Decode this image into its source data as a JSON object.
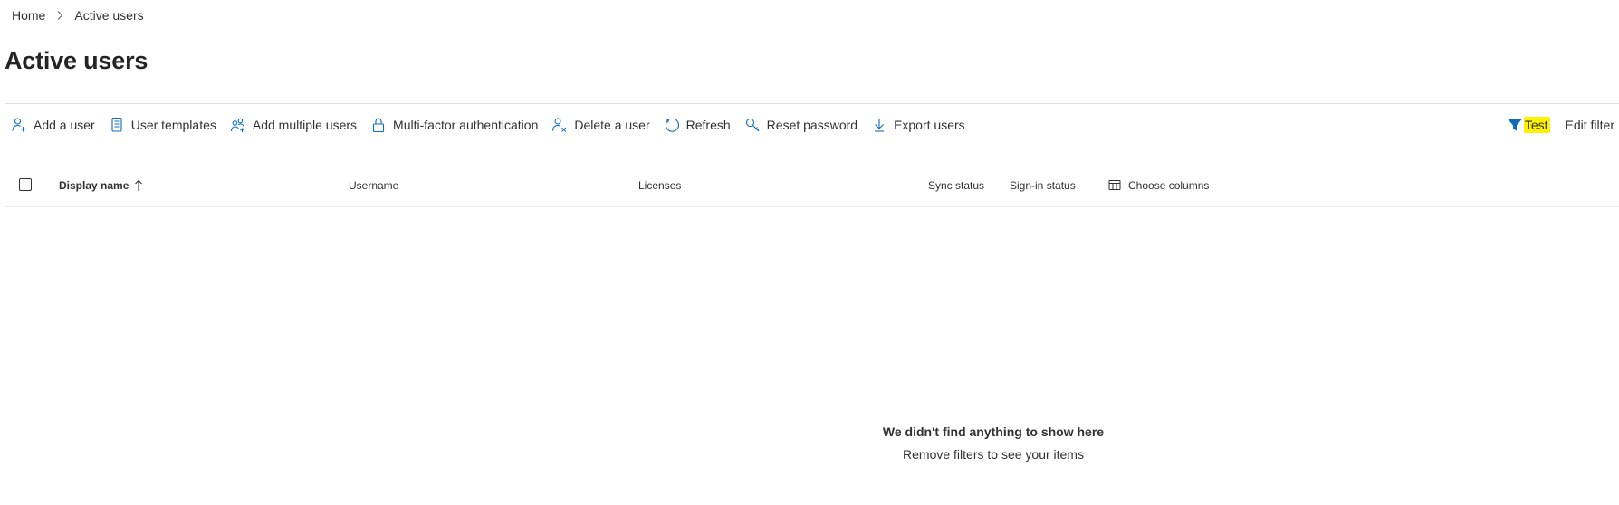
{
  "breadcrumb": {
    "home": "Home",
    "current": "Active users"
  },
  "page": {
    "title": "Active users"
  },
  "toolbar": {
    "add_user": "Add a user",
    "user_templates": "User templates",
    "add_multiple": "Add multiple users",
    "mfa": "Multi-factor authentication",
    "delete_user": "Delete a user",
    "refresh": "Refresh",
    "reset_password": "Reset password",
    "export_users": "Export users"
  },
  "filter": {
    "active_filter": "Test",
    "edit_label": "Edit filter"
  },
  "table": {
    "columns": {
      "display_name": "Display name",
      "username": "Username",
      "licenses": "Licenses",
      "sync_status": "Sync status",
      "signin_status": "Sign-in status",
      "choose_columns": "Choose columns"
    }
  },
  "empty": {
    "title": "We didn't find anything to show here",
    "subtitle": "Remove filters to see your items"
  },
  "colors": {
    "accent": "#0f6cbd",
    "highlight": "#fff200",
    "text": "#323130",
    "divider": "#e1dfdd"
  },
  "icons": {
    "add_user": "person-add-icon",
    "user_templates": "document-list-icon",
    "add_multiple": "people-add-icon",
    "mfa": "lock-icon",
    "delete_user": "person-delete-icon",
    "refresh": "refresh-icon",
    "reset_password": "key-icon",
    "export_users": "download-arrow-icon",
    "filter": "filter-icon",
    "sort": "arrow-up-icon",
    "choose_columns": "table-columns-icon"
  }
}
